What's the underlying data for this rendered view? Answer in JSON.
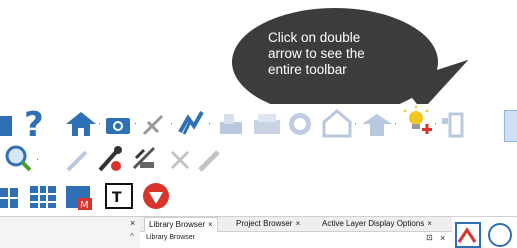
{
  "callout": {
    "line1": "Click on double",
    "line2": "arrow to see the",
    "line3": "entire toolbar"
  },
  "toolbar_row1": {
    "icons": [
      "help-icon",
      "home-icon",
      "camera-icon",
      "measure-icon",
      "graph-icon",
      "print-icon",
      "printer-icon",
      "record-icon",
      "house-outline-icon",
      "house-frame-icon",
      "light-bulb-icon",
      "door-icon",
      "overflow-double-arrow-icon"
    ]
  },
  "toolbar_row2": {
    "icons": [
      "zoom-icon",
      "eyedropper-icon",
      "paint-icon",
      "magic-icon",
      "ruler-icon",
      "pencil-icon"
    ]
  },
  "toolbar_row3": {
    "icons": [
      "grid-icon",
      "library-icon",
      "material-icon",
      "text-icon",
      "render-icon"
    ]
  },
  "left_panel": {
    "close_label": "×",
    "scroll_up_label": "^"
  },
  "tabs": [
    {
      "label": "Library Browser",
      "close": "×",
      "active": true
    },
    {
      "label": "Project Browser",
      "close": "×",
      "active": false
    },
    {
      "label": "Active Layer Display Options",
      "close": "×",
      "active": false
    }
  ],
  "subpanel": {
    "title": "Library Browser",
    "pin": "⊡",
    "close": "×"
  }
}
